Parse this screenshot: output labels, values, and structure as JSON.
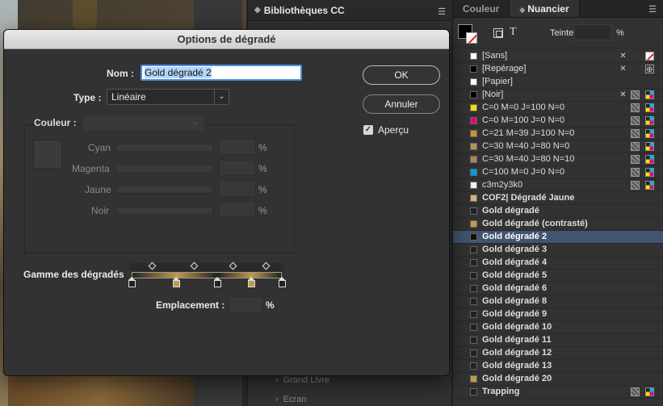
{
  "cc_panel": {
    "title": "Bibliothèques CC",
    "menu_icon": "hamburger-icon",
    "items": [
      {
        "label": "Grand Livre"
      },
      {
        "label": "Ecran"
      }
    ]
  },
  "swatches_panel": {
    "tabs": [
      {
        "label": "Couleur"
      },
      {
        "label": "Nuancier"
      }
    ],
    "tint_label": "Teinte :",
    "tint_value": "",
    "tint_unit": "%",
    "text_tool_glyph": "T",
    "swatches": [
      {
        "name": "[Sans]",
        "color": "#ffffff",
        "icons": [
          "non-editable",
          "none"
        ]
      },
      {
        "name": "[Repérage]",
        "color": "#000000",
        "icons": [
          "non-editable",
          "registration"
        ]
      },
      {
        "name": "[Papier]",
        "color": "#ffffff",
        "icons": []
      },
      {
        "name": "[Noir]",
        "color": "#000000",
        "icons": [
          "non-editable",
          "process",
          "cmyk"
        ]
      },
      {
        "name": "C=0 M=0 J=100 N=0",
        "color": "#ffe000",
        "icons": [
          "process",
          "cmyk"
        ]
      },
      {
        "name": "C=0 M=100 J=0 N=0",
        "color": "#e5007e",
        "icons": [
          "process",
          "cmyk"
        ]
      },
      {
        "name": "C=21 M=39 J=100 N=0",
        "color": "#c9952a",
        "icons": [
          "process",
          "cmyk"
        ]
      },
      {
        "name": "C=30 M=40 J=80 N=0",
        "color": "#b59461",
        "icons": [
          "process",
          "cmyk"
        ]
      },
      {
        "name": "C=30 M=40 J=80 N=10",
        "color": "#a88a58",
        "icons": [
          "process",
          "cmyk"
        ]
      },
      {
        "name": "C=100 M=0 J=0 N=0",
        "color": "#009ee3",
        "icons": [
          "process",
          "cmyk"
        ]
      },
      {
        "name": "c3m2y3k0",
        "color": "#f4f2ef",
        "icons": [
          "process",
          "cmyk"
        ]
      },
      {
        "name": "COF2| Dégradé Jaune",
        "color": "#d8b67a",
        "icons": [],
        "bold": true
      },
      {
        "name": "Gold dégradé",
        "color": "#222222",
        "icons": [],
        "bold": true
      },
      {
        "name": "Gold dégradé (contrasté)",
        "color": "#c49a4a",
        "icons": [],
        "bold": true
      },
      {
        "name": "Gold dégradé 2",
        "color": "#111111",
        "icons": [],
        "selected": true
      },
      {
        "name": "Gold dégradé 3",
        "color": "#222222",
        "icons": [],
        "bold": true
      },
      {
        "name": "Gold dégradé 4",
        "color": "#222222",
        "icons": [],
        "bold": true
      },
      {
        "name": "Gold dégradé 5",
        "color": "#222222",
        "icons": [],
        "bold": true
      },
      {
        "name": "Gold dégradé 6",
        "color": "#222222",
        "icons": [],
        "bold": true
      },
      {
        "name": "Gold dégradé 8",
        "color": "#222222",
        "icons": [],
        "bold": true
      },
      {
        "name": "Gold dégradé 9",
        "color": "#222222",
        "icons": [],
        "bold": true
      },
      {
        "name": "Gold dégradé 10",
        "color": "#222222",
        "icons": [],
        "bold": true
      },
      {
        "name": "Gold dégradé 11",
        "color": "#222222",
        "icons": [],
        "bold": true
      },
      {
        "name": "Gold dégradé 12",
        "color": "#222222",
        "icons": [],
        "bold": true
      },
      {
        "name": "Gold dégradé 13",
        "color": "#222222",
        "icons": [],
        "bold": true
      },
      {
        "name": "Gold dégradé 20",
        "color": "#c49a4a",
        "icons": [],
        "bold": true
      },
      {
        "name": "Trapping",
        "color": "#222222",
        "icons": [
          "process",
          "cmyk"
        ],
        "bold": true
      }
    ]
  },
  "dialog": {
    "title": "Options de dégradé",
    "name_label": "Nom :",
    "name_value": "Gold dégradé 2",
    "type_label": "Type :",
    "type_value": "Linéaire",
    "ok_label": "OK",
    "cancel_label": "Annuler",
    "preview_label": "Aperçu",
    "preview_checked": true,
    "color_label": "Couleur :",
    "channels": [
      {
        "label": "Cyan",
        "unit": "%"
      },
      {
        "label": "Magenta",
        "unit": "%"
      },
      {
        "label": "Jaune",
        "unit": "%"
      },
      {
        "label": "Noir",
        "unit": "%"
      }
    ],
    "ramp_label": "Gamme des dégradés",
    "location_label": "Emplacement :",
    "location_unit": "%",
    "ramp_stops": [
      {
        "pos": 0,
        "color": "#222222"
      },
      {
        "pos": 0.3,
        "color": "#c49a4a"
      },
      {
        "pos": 0.57,
        "color": "#222222"
      },
      {
        "pos": 0.8,
        "color": "#c49a4a"
      },
      {
        "pos": 1,
        "color": "#222222"
      }
    ],
    "ramp_midpoints": [
      0.14,
      0.42,
      0.68,
      0.9
    ]
  }
}
